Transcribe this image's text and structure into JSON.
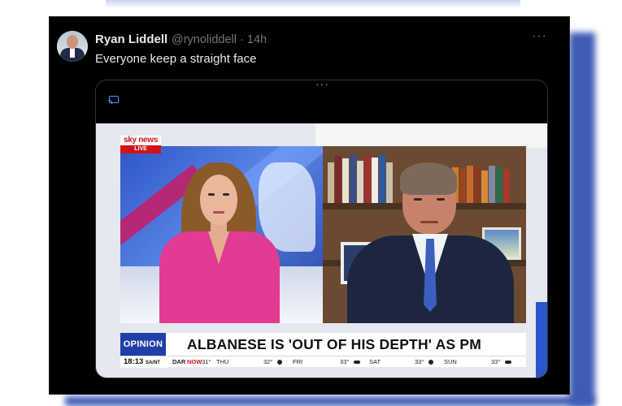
{
  "tweet": {
    "display_name": "Ryan Liddell",
    "handle_time": "@rynoliddell · 14h",
    "more": "···",
    "text": "Everyone keep a straight face"
  },
  "media": {
    "dots": "···",
    "channel_logo_top": "sky news",
    "channel_logo_bottom": "LIVE",
    "tag": "OPINION",
    "headline": "ALBANESE IS 'OUT OF HIS DEPTH' AS PM",
    "ticker": {
      "time": "18:13",
      "tz": "SA/NT",
      "location": "DAR",
      "now_label": "NOW",
      "now_temp": "31°",
      "days": [
        {
          "day": "THU",
          "temp": "32°"
        },
        {
          "day": "FRI",
          "temp": "33°"
        },
        {
          "day": "SAT",
          "temp": "33°"
        },
        {
          "day": "SUN",
          "temp": "33°"
        }
      ]
    }
  },
  "colors": {
    "tweet_bg": "#000000",
    "accent_blue": "#1f3fa8",
    "sky_red": "#d2121b",
    "jacket_pink": "#e23b93"
  }
}
